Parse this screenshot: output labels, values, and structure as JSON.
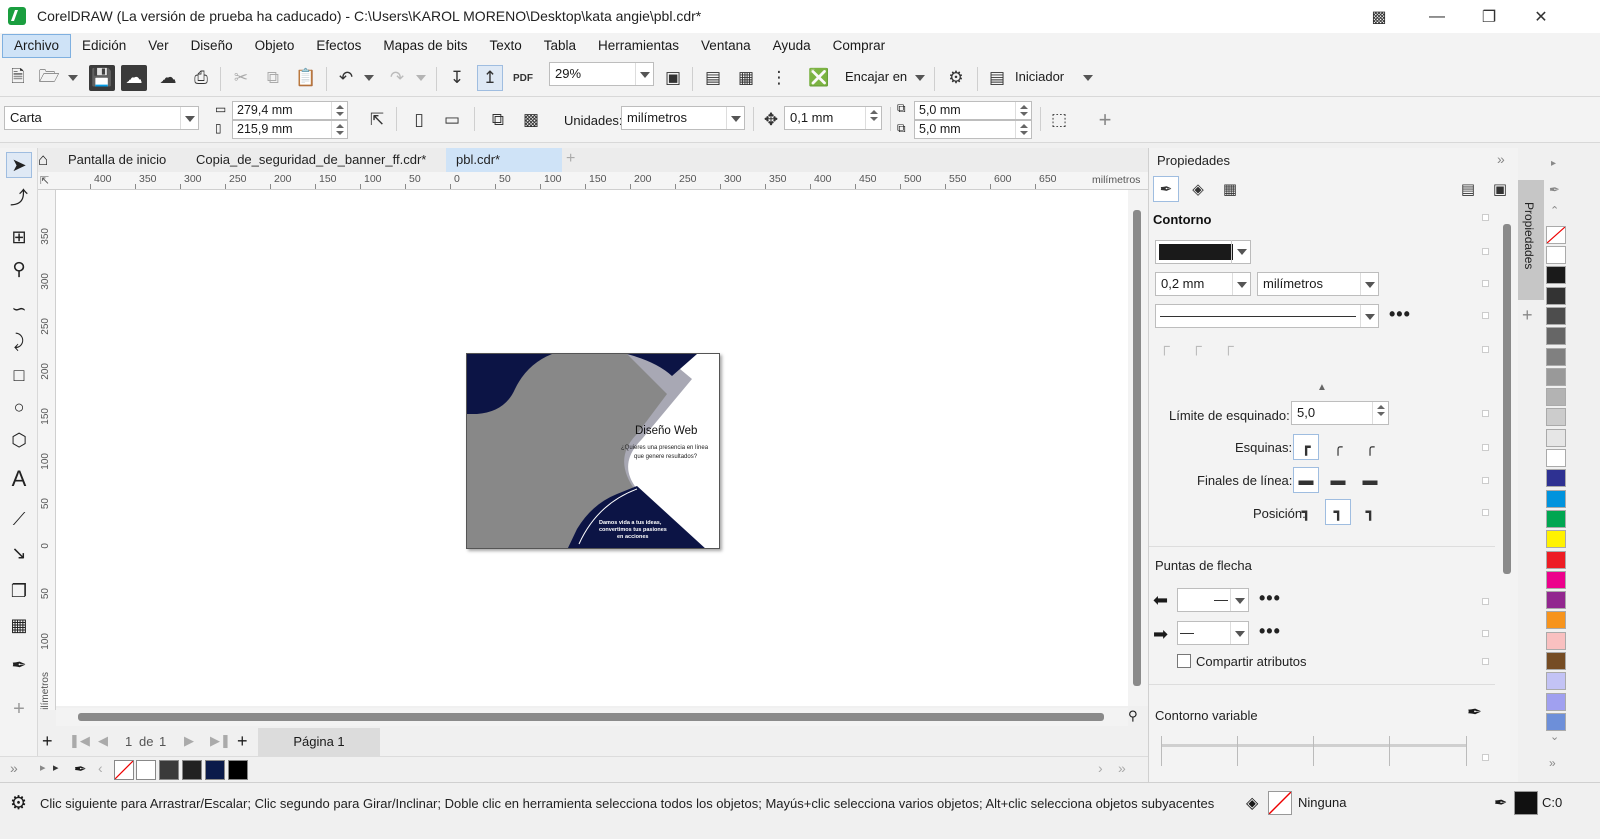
{
  "window": {
    "title": "CorelDRAW (La versión de prueba ha caducado) - C:\\Users\\KAROL MORENO\\Desktop\\kata angie\\pbl.cdr*"
  },
  "menu": [
    "Archivo",
    "Edición",
    "Ver",
    "Diseño",
    "Objeto",
    "Efectos",
    "Mapas de bits",
    "Texto",
    "Tabla",
    "Herramientas",
    "Ventana",
    "Ayuda",
    "Comprar"
  ],
  "toolbar": {
    "zoom": "29%",
    "snap_label": "Encajar en",
    "launcher_label": "Iniciador"
  },
  "propbar": {
    "page_size": "Carta",
    "width": "279,4 mm",
    "height": "215,9 mm",
    "units_label": "Unidades:",
    "units_value": "milímetros",
    "nudge": "0,1 mm",
    "dup_x": "5,0 mm",
    "dup_y": "5,0 mm"
  },
  "tabs": [
    "Pantalla de inicio",
    "Copia_de_seguridad_de_banner_ff.cdr*",
    "pbl.cdr*"
  ],
  "ruler": {
    "h_ticks": [
      "400",
      "350",
      "300",
      "250",
      "200",
      "150",
      "100",
      "50",
      "0",
      "50",
      "100",
      "150",
      "200",
      "250",
      "300",
      "350",
      "400",
      "450",
      "500",
      "550",
      "600",
      "650"
    ],
    "h_unit": "milímetros",
    "v_ticks": [
      "350",
      "300",
      "250",
      "200",
      "150",
      "100",
      "50",
      "0",
      "50",
      "100"
    ],
    "v_unit": "milímetros"
  },
  "artwork": {
    "heading": "Diseño Web",
    "subtext_1": "¿Quieres una presencia en línea",
    "subtext_2": "que genere resultados?",
    "footer_1": "Damos vida a tus ideas,",
    "footer_2": "convertimos tus pasiones",
    "footer_3": "en acciones"
  },
  "pagenav": {
    "current": "1",
    "of_label": "de",
    "total": "1",
    "page_tab": "Página 1"
  },
  "docker": {
    "title": "Propiedades",
    "section": "Contorno",
    "outline_width": "0,2 mm",
    "outline_units": "milímetros",
    "miter_label": "Límite de esquinado:",
    "miter_value": "5,0",
    "corners_label": "Esquinas:",
    "caps_label": "Finales de línea:",
    "position_label": "Posición:",
    "arrowheads_label": "Puntas de flecha",
    "share_attr": "Compartir atributos",
    "variable_label": "Contorno variable",
    "side_tab": "Propiedades"
  },
  "status": {
    "message": "Clic siguiente para Arrastrar/Escalar; Clic segundo para Girar/Inclinar; Doble clic en herramienta selecciona todos los objetos; Mayús+clic selecciona varios objetos; Alt+clic selecciona objetos subyacentes",
    "fill_label": "Ninguna",
    "outline_label": "C:0"
  },
  "palette_colors": [
    "#ffffff",
    "#1a1a1a",
    "#333333",
    "#4d4d4d",
    "#666666",
    "#808080",
    "#999999",
    "#b3b3b3",
    "#cccccc",
    "#e6e6e6",
    "#ffffff",
    "#2e3192",
    "#0093dd",
    "#00a651",
    "#fff200",
    "#ed1c24",
    "#ec008c",
    "#92278f",
    "#f7941d",
    "#f9c0c0",
    "#754c24",
    "#c3c3f5",
    "#a0a0f0",
    "#6d8fd9"
  ],
  "doc_palette_colors": [
    "#ffffff",
    "#3a3a3a",
    "#222222",
    "#0a1a4a",
    "#000000"
  ],
  "colors": {
    "accent": "#cfe3f7",
    "navy": "#0c1445"
  }
}
